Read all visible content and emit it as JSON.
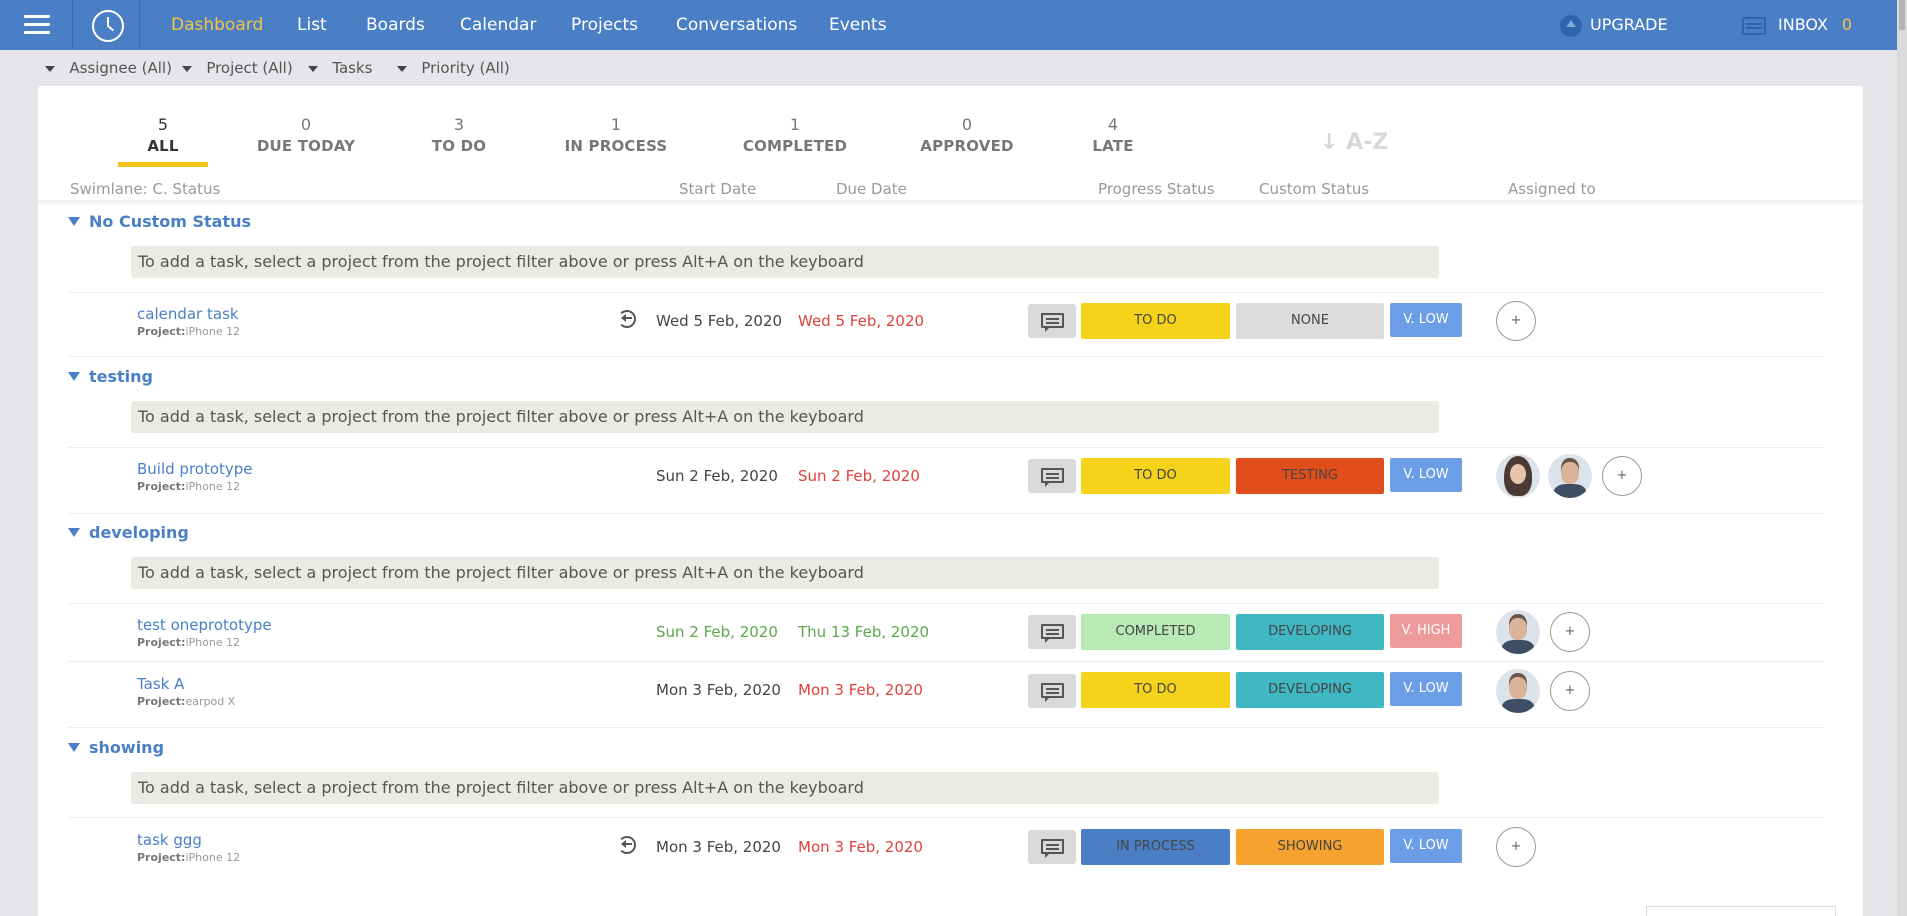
{
  "nav": {
    "items": [
      "Dashboard",
      "List",
      "Boards",
      "Calendar",
      "Projects",
      "Conversations",
      "Events"
    ],
    "active": "Dashboard",
    "upgrade": "UPGRADE",
    "inbox": "INBOX",
    "inbox_count": "0"
  },
  "filters": [
    "Assignee (All)",
    "Project (All)",
    "Tasks",
    "Priority (All)"
  ],
  "stats": [
    {
      "num": "5",
      "label": "ALL"
    },
    {
      "num": "0",
      "label": "DUE TODAY"
    },
    {
      "num": "3",
      "label": "TO DO"
    },
    {
      "num": "1",
      "label": "IN PROCESS"
    },
    {
      "num": "1",
      "label": "COMPLETED"
    },
    {
      "num": "0",
      "label": "APPROVED"
    },
    {
      "num": "4",
      "label": "LATE"
    }
  ],
  "sort_label": "↓ A-Z",
  "columns": {
    "swimlane": "Swimlane: C. Status",
    "start": "Start Date",
    "due": "Due Date",
    "progress": "Progress Status",
    "custom": "Custom Status",
    "assigned": "Assigned to"
  },
  "add_hint": "To add a task, select a project from the project filter above or press Alt+A on the keyboard",
  "project_prefix": "Project:",
  "add_symbol": "+",
  "colors": {
    "accent": "#4a7fc5",
    "todo": "#f5d31b",
    "completed": "#b9eab5",
    "inprocess": "#4a7fc5",
    "testing": "#e24e1b",
    "developing": "#3fb8c4",
    "showing": "#f5a22f",
    "none": "#dcdcdc",
    "vlow": "#6c9ee8",
    "vhigh": "#ee9a9a"
  },
  "groups": [
    {
      "title": "No Custom Status",
      "tasks": [
        {
          "name": "calendar task",
          "project": "iPhone 12",
          "recurring": true,
          "start": "Wed 5 Feb, 2020",
          "due": "Wed 5 Feb, 2020",
          "progress": "TO DO",
          "custom": "NONE",
          "priority": "V. LOW",
          "assignees": []
        }
      ]
    },
    {
      "title": "testing",
      "tasks": [
        {
          "name": "Build prototype",
          "project": "iPhone 12",
          "recurring": false,
          "start": "Sun 2 Feb, 2020",
          "due": "Sun 2 Feb, 2020",
          "progress": "TO DO",
          "custom": "TESTING",
          "priority": "V. LOW",
          "assignees": [
            "woman-avatar",
            "man-avatar"
          ]
        }
      ]
    },
    {
      "title": "developing",
      "tasks": [
        {
          "name": "test oneprototype",
          "project": "iPhone 12",
          "recurring": false,
          "start": "Sun 2 Feb, 2020",
          "due": "Thu 13 Feb, 2020",
          "progress": "COMPLETED",
          "custom": "DEVELOPING",
          "priority": "V. HIGH",
          "assignees": [
            "man-avatar"
          ]
        },
        {
          "name": "Task A",
          "project": "earpod X",
          "recurring": false,
          "start": "Mon 3 Feb, 2020",
          "due": "Mon 3 Feb, 2020",
          "progress": "TO DO",
          "custom": "DEVELOPING",
          "priority": "V. LOW",
          "assignees": [
            "man-avatar"
          ]
        }
      ]
    },
    {
      "title": "showing",
      "tasks": [
        {
          "name": "task ggg",
          "project": "iPhone 12",
          "recurring": true,
          "start": "Mon 3 Feb, 2020",
          "due": "Mon 3 Feb, 2020",
          "progress": "IN PROCESS",
          "custom": "SHOWING",
          "priority": "V. LOW",
          "assignees": []
        }
      ]
    }
  ]
}
